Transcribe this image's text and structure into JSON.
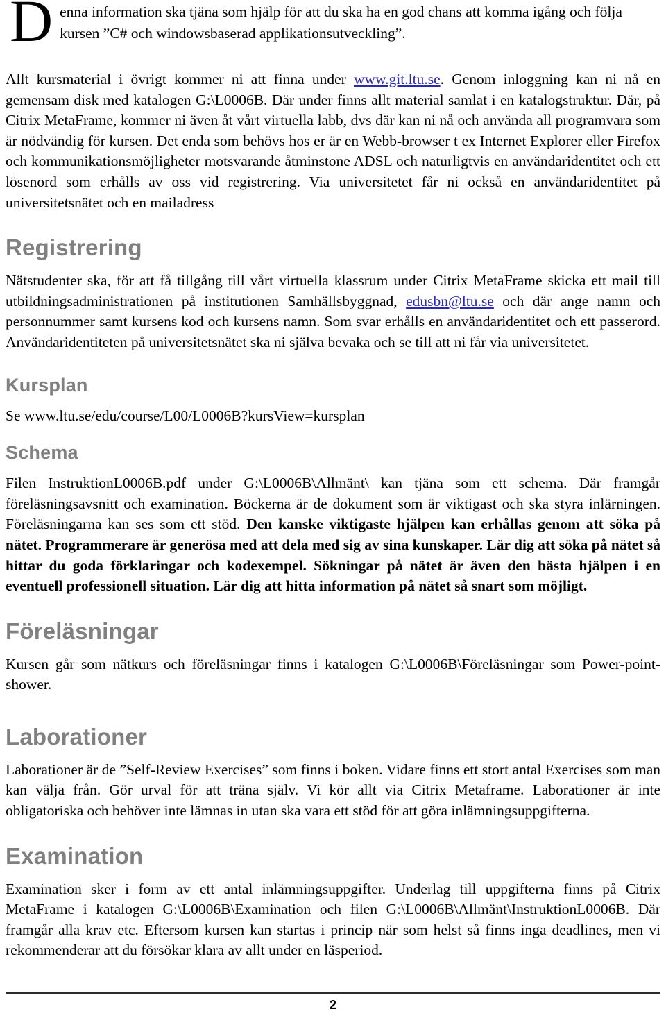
{
  "document": {
    "dropcap": "D",
    "intro_paragraph": "enna information ska tjäna som hjälp för att du ska ha en god chans att komma igång och följa kursen ”C# och windowsbaserad applikationsutveckling”.",
    "intro_paragraph_line1": "enna information ska tjäna som hjälp för att du ska ha en god chans att komma igång och följa",
    "intro_paragraph_line2": "kursen ”C# och windowsbaserad applikationsutveckling”."
  },
  "body": {
    "p1_part1": "Allt kursmaterial i övrigt kommer ni att finna under ",
    "p1_link1": "www.git.ltu.se",
    "p1_part2": ". Genom inloggning kan ni nå en gemensam disk med katalogen G:\\L0006B. Där under finns allt material samlat i en katalogstruktur. Där, på Citrix MetaFrame, kommer ni även åt vårt virtuella labb, dvs där kan ni nå och använda all programvara som är nödvändig för kursen. Det enda som behövs hos er är en Webb-browser t ex Internet Explorer eller Firefox och kommunikationsmöjligheter motsvarande åtminstone ADSL och naturligtvis en användaridentitet och ett lösenord som erhålls av oss vid registrering. Via universitetet får ni också en användaridentitet på universitetsnätet och en mailadress"
  },
  "sections": {
    "registrering": {
      "heading": "Registrering",
      "p_part1": "Nätstudenter ska, för att få tillgång till vårt virtuella klassrum under Citrix MetaFrame skicka ett mail till utbildningsadministrationen på institutionen Samhällsbyggnad, ",
      "p_link": "edusbn@ltu.se",
      "p_part2": " och där ange namn och personnummer samt kursens kod och kursens namn. Som svar erhålls en användaridentitet och ett passerord. Användaridentiteten på universitetsnätet ska ni själva bevaka och se till att ni får via universitetet."
    },
    "kursplan": {
      "heading": "Kursplan",
      "paragraph": "Se www.ltu.se/edu/course/L00/L0006B?kursView=kursplan"
    },
    "schema": {
      "heading": "Schema",
      "p_normal": "Filen InstruktionL0006B.pdf under G:\\L0006B\\Allmänt\\ kan tjäna som ett schema. Där framgår föreläsningsavsnitt och examination. Böckerna är de dokument som är viktigast och ska styra inlärningen. Föreläsningarna kan ses som ett stöd. ",
      "p_bold": "Den kanske viktigaste hjälpen kan erhållas genom att söka på nätet. Programmerare är generösa med att dela med sig av sina kunskaper. Lär dig att söka på nätet så hittar du goda förklaringar och kodexempel. Sökningar på nätet är även den bästa hjälpen i en eventuell professionell situation. Lär dig att hitta information på nätet så snart som möjligt."
    },
    "forelasningar": {
      "heading": "Föreläsningar",
      "paragraph": "Kursen går som nätkurs och föreläsningar finns i katalogen G:\\L0006B\\Föreläsningar som Power-point-shower."
    },
    "laborationer": {
      "heading": "Laborationer",
      "paragraph": "Laborationer är de ”Self-Review Exercises” som finns i boken. Vidare finns ett stort antal Exercises som man kan välja från. Gör urval för att träna själv. Vi kör allt via Citrix Metaframe. Laborationer är inte obligatoriska och behöver inte lämnas in utan ska vara ett stöd för att göra inlämningsuppgifterna."
    },
    "examination": {
      "heading": "Examination",
      "paragraph": "Examination sker i form av ett antal inlämningsuppgifter. Underlag till uppgifterna finns på Citrix MetaFrame i katalogen G:\\L0006B\\Examination och filen G:\\L0006B\\Allmänt\\InstruktionL0006B. Där framgår alla krav etc. Eftersom kursen kan startas i princip när som helst så finns inga deadlines, men vi rekommenderar att du försökar klara av allt under en läsperiod."
    }
  },
  "footer": {
    "page_number": "2"
  },
  "colors": {
    "heading_gray": "#808080",
    "link_blue": "#2a2ab0",
    "text_black": "#000000",
    "rule_dark": "#2b2b2b"
  }
}
